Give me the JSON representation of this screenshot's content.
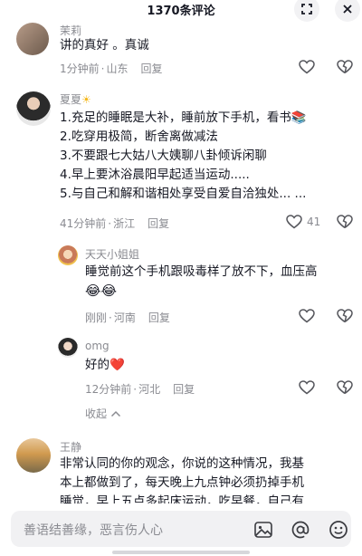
{
  "header": {
    "title": "1370条评论"
  },
  "comments": [
    {
      "username": "茉莉",
      "text": "讲的真好 。真诚",
      "time": "1分钟前",
      "location": "山东",
      "reply": "回复"
    },
    {
      "username": "夏夏",
      "username_decor": "☀",
      "lines": [
        "1.充足的睡眠是大补，睡前放下手机，看书📚",
        "2.吃穿用极简，断舍离做减法",
        "3.不要跟七大姑八大姨聊八卦倾诉闲聊",
        "4.早上要沐浴晨阳早起适当运动.....",
        "5.与自己和解和谐相处享受自爱自洽独处... ..."
      ],
      "time": "41分钟前",
      "location": "浙江",
      "reply": "回复",
      "likes": "41"
    },
    {
      "username": "天天小姐姐",
      "text": "睡觉前这个手机跟吸毒样了放不下，血压高",
      "emoji": "😂😂",
      "time": "刚刚",
      "location": "河南",
      "reply": "回复"
    },
    {
      "username": "omg",
      "text": "好的",
      "emoji": "❤️",
      "time": "12分钟前",
      "location": "河北",
      "reply": "回复"
    },
    {
      "username": "王静",
      "lines": [
        "非常认同的你的观念，你说的这种情况，我基",
        "本上都做到了，每天晚上九点钟必须扔掉手机",
        "睡觉，早上五点多起床运动，吃早餐，自己有"
      ]
    }
  ],
  "collapse_label": "收起",
  "input": {
    "placeholder": "善语结善缘，恶言伤人心"
  },
  "colors": {
    "text": "#161823",
    "secondary": "#8a8b91",
    "heart": "#fe2c55"
  },
  "icons": [
    "expand-icon",
    "close-icon",
    "heart-outline-icon",
    "broken-heart-icon",
    "image-icon",
    "at-icon",
    "emoji-icon",
    "chevron-up-icon"
  ]
}
